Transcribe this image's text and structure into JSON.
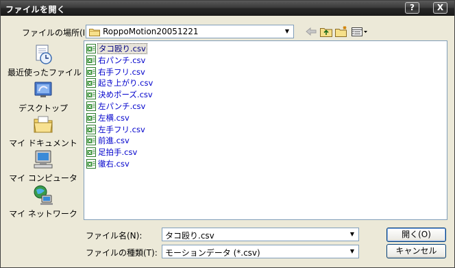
{
  "window": {
    "title": "ファイルを開く"
  },
  "titlebar": {
    "help_glyph": "?",
    "close_glyph": "X"
  },
  "location": {
    "label": "ファイルの場所(I):",
    "value": "RoppoMotion20051221"
  },
  "places": [
    {
      "label": "最近使ったファイル",
      "icon": "recent-documents-icon"
    },
    {
      "label": "デスクトップ",
      "icon": "desktop-icon"
    },
    {
      "label": "マイ ドキュメント",
      "icon": "my-documents-icon"
    },
    {
      "label": "マイ コンピュータ",
      "icon": "my-computer-icon"
    },
    {
      "label": "マイ ネットワーク",
      "icon": "my-network-icon"
    }
  ],
  "files": [
    "タコ殴り.csv",
    "右パンチ.csv",
    "右手フリ.csv",
    "起き上がり.csv",
    "決めポーズ.csv",
    "左パンチ.csv",
    "左横.csv",
    "左手フリ.csv",
    "前進.csv",
    "足拍手.csv",
    "徹右.csv"
  ],
  "selected_file_index": 0,
  "filename": {
    "label": "ファイル名(N):",
    "value": "タコ殴り.csv"
  },
  "filetype": {
    "label": "ファイルの種類(T):",
    "value": "モーションデータ (*.csv)"
  },
  "buttons": {
    "open": "開く(O)",
    "cancel": "キャンセル"
  },
  "colors": {
    "titlebar": "#2b2b2b",
    "dialog_bg": "#ece9d8",
    "file_text": "#0000cc",
    "field_border": "#7f9db9"
  }
}
